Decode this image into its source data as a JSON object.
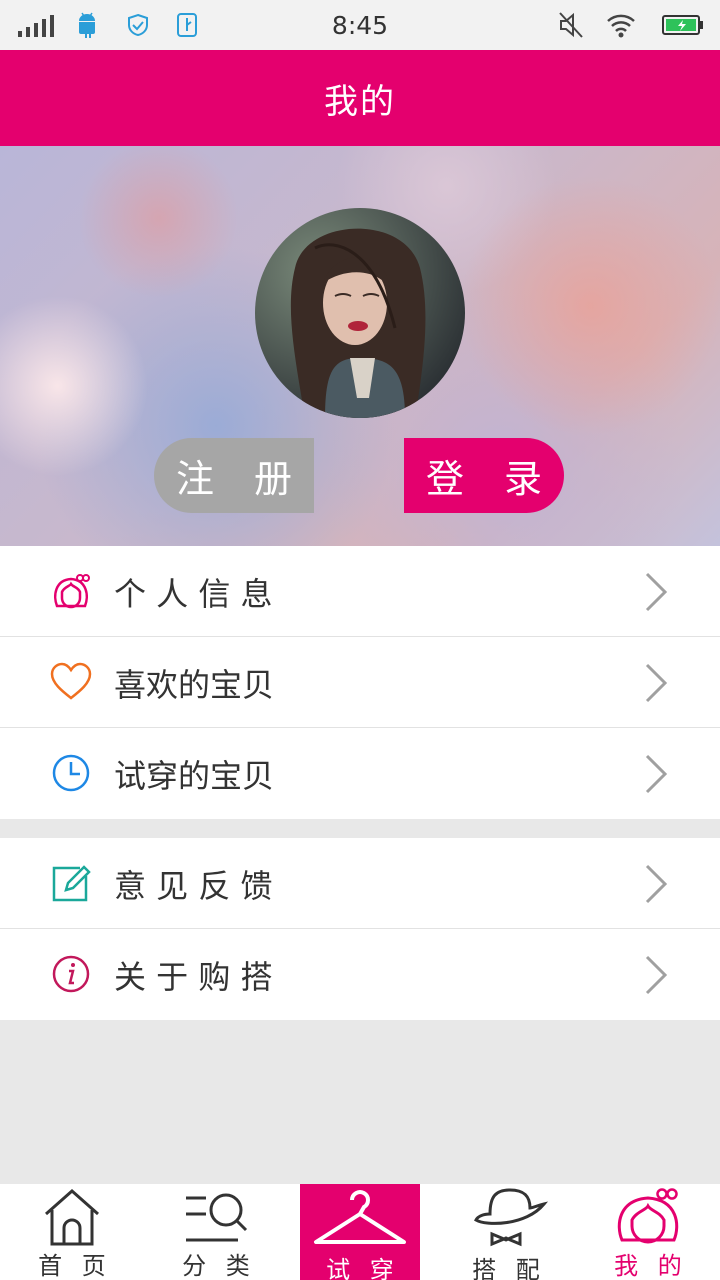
{
  "status_bar": {
    "time": "8:45"
  },
  "header": {
    "title": "我的"
  },
  "hero": {
    "register_label": "注 册",
    "login_label": "登 录"
  },
  "menu_group1": [
    {
      "label": "个 人 信 息",
      "icon": "user-girl-icon",
      "icon_color": "#e4006e"
    },
    {
      "label": "喜欢的宝贝",
      "icon": "heart-icon",
      "icon_color": "#f07020"
    },
    {
      "label": "试穿的宝贝",
      "icon": "clock-icon",
      "icon_color": "#1e88e5"
    }
  ],
  "menu_group2": [
    {
      "label": "意 见 反 馈",
      "icon": "edit-icon",
      "icon_color": "#1aa89a"
    },
    {
      "label": "关 于 购 搭",
      "icon": "info-icon",
      "icon_color": "#c2185b"
    }
  ],
  "tabbar": [
    {
      "label": "首 页",
      "icon": "home-icon"
    },
    {
      "label": "分 类",
      "icon": "category-search-icon"
    },
    {
      "label": "试 穿",
      "icon": "hanger-icon",
      "active": true
    },
    {
      "label": "搭 配",
      "icon": "hat-bowtie-icon"
    },
    {
      "label": "我 的",
      "icon": "user-girl-icon"
    }
  ],
  "colors": {
    "accent": "#e4006e",
    "register_bg": "#a6a6a6"
  }
}
